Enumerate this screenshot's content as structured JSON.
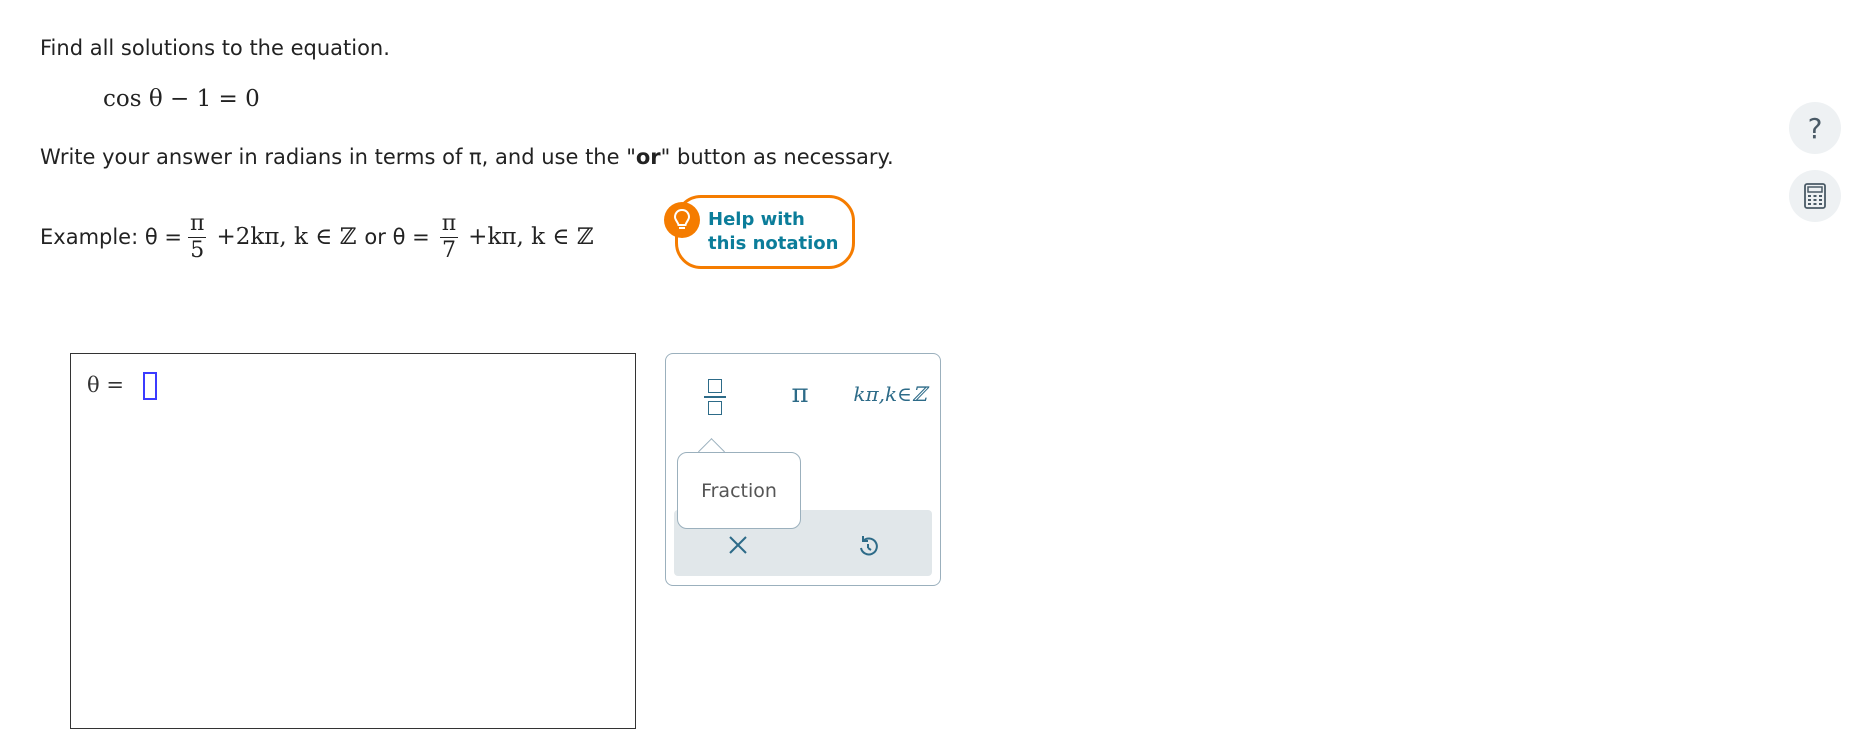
{
  "question": {
    "prompt": "Find all solutions to the equation.",
    "equation": "cos θ − 1 = 0",
    "instruction_pre": "Write your answer in radians in terms of π, and use the \"",
    "instruction_bold": "or",
    "instruction_post": "\" button as necessary."
  },
  "example": {
    "label": "Example: θ =",
    "frac1_num": "π",
    "frac1_den": "5",
    "term1": "+2kπ, k ∈ ℤ",
    "or_text": "or θ =",
    "frac2_num": "π",
    "frac2_den": "7",
    "term2": "+kπ, k ∈ ℤ"
  },
  "help_notation": {
    "line1": "Help with",
    "line2": "this notation",
    "icon": "lightbulb-icon"
  },
  "answer": {
    "theta_label": "θ  ="
  },
  "palette": {
    "buttons": [
      {
        "name": "fraction",
        "icon": "fraction-icon"
      },
      {
        "name": "pi",
        "label": "π"
      },
      {
        "name": "k-pi-integer",
        "label": "kπ,k∈ℤ"
      }
    ],
    "tooltip": "Fraction",
    "clear_icon": "close-icon",
    "undo_icon": "undo-icon"
  },
  "sidebar": {
    "help_label": "?",
    "help_icon": "question-icon",
    "calc_icon": "calculator-icon"
  },
  "colors": {
    "accent_orange": "#f57c00",
    "link_teal": "#0b7d9a",
    "palette_blue": "#2d6b88",
    "cursor_blue": "#3b3bff"
  }
}
